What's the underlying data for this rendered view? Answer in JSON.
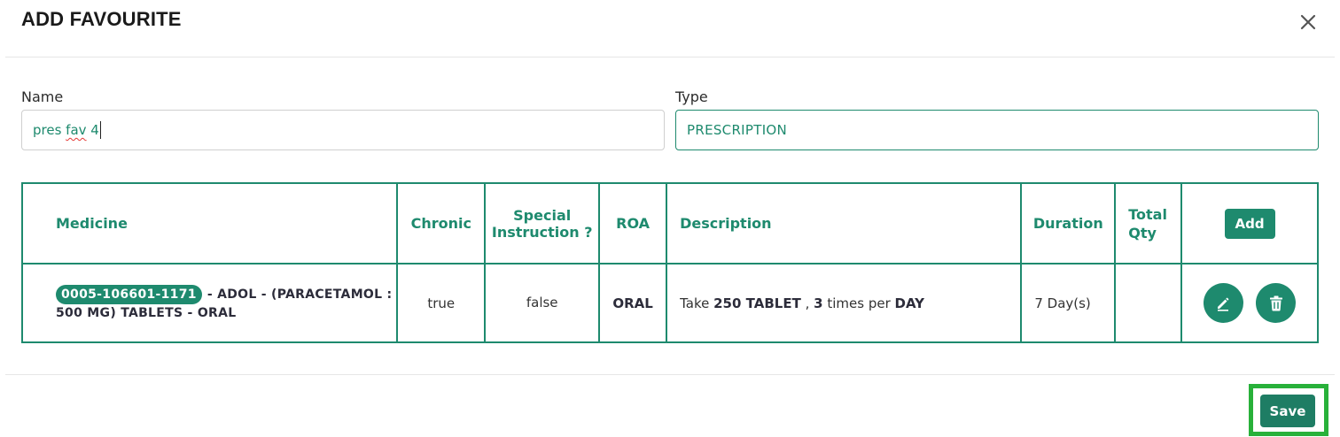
{
  "dialog": {
    "title": "ADD FAVOURITE",
    "close_icon": "close-icon"
  },
  "form": {
    "name_label": "Name",
    "name_value_prefix": "pres ",
    "name_value_misspelled": "fav",
    "name_value_suffix": " 4",
    "type_label": "Type",
    "type_value": "PRESCRIPTION"
  },
  "table": {
    "headers": {
      "medicine": "Medicine",
      "chronic": "Chronic",
      "special_instruction": "Special Instruction ?",
      "roa": "ROA",
      "description": "Description",
      "duration": "Duration",
      "total_qty": "Total Qty",
      "add_button": "Add"
    },
    "rows": [
      {
        "code": "0005-106601-1171",
        "medicine_name": "- ADOL - (PARACETAMOL : 500 MG) TABLETS - ORAL",
        "chronic": "true",
        "special_instruction": "false",
        "roa": "ORAL",
        "desc_take": "Take",
        "desc_dose": "250 TABLET",
        "desc_sep": ",",
        "desc_freq": "3",
        "desc_times_per": "times per",
        "desc_period": "DAY",
        "duration": "7 Day(s)",
        "total_qty": "",
        "actions": [
          "edit-icon",
          "trash-icon"
        ]
      }
    ]
  },
  "footer": {
    "save_label": "Save"
  },
  "colors": {
    "accent": "#1e8a6e",
    "highlight_frame": "#28b13a"
  }
}
